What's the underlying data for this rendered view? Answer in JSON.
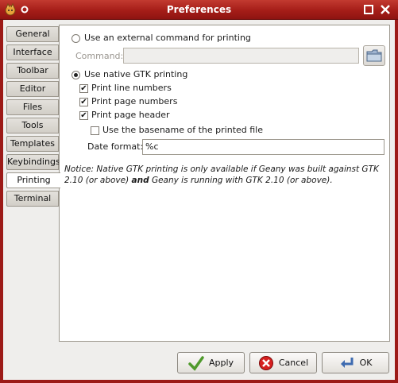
{
  "window": {
    "title": "Preferences"
  },
  "tabs": [
    {
      "label": "General"
    },
    {
      "label": "Interface"
    },
    {
      "label": "Toolbar"
    },
    {
      "label": "Editor"
    },
    {
      "label": "Files"
    },
    {
      "label": "Tools"
    },
    {
      "label": "Templates"
    },
    {
      "label": "Keybindings"
    },
    {
      "label": "Printing",
      "active": true
    },
    {
      "label": "Terminal"
    }
  ],
  "printing": {
    "external_label": "Use an external command for printing",
    "external_selected": false,
    "command_label": "Command:",
    "command_value": "",
    "native_label": "Use native GTK printing",
    "native_selected": true,
    "line_numbers_label": "Print line numbers",
    "line_numbers_checked": true,
    "page_numbers_label": "Print page numbers",
    "page_numbers_checked": true,
    "page_header_label": "Print page header",
    "page_header_checked": true,
    "basename_label": "Use the basename of the printed file",
    "basename_checked": false,
    "date_format_label": "Date format:",
    "date_format_value": "%c",
    "notice_1": "Notice: Native GTK printing is only available if Geany was built against GTK 2.10 (or above) ",
    "notice_bold": "and",
    "notice_2": " Geany is running with GTK 2.10 (or above)."
  },
  "buttons": {
    "apply_label": "Apply",
    "cancel_label": "Cancel",
    "ok_label": "OK"
  }
}
